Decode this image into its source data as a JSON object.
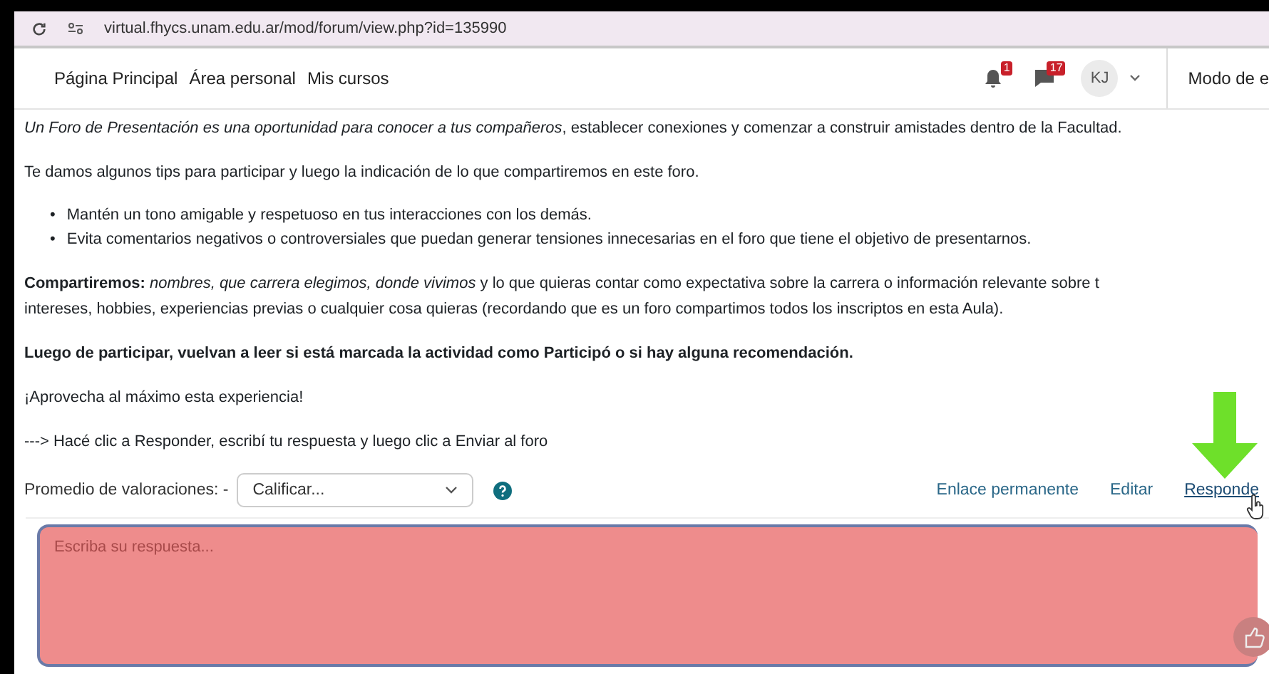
{
  "browser": {
    "url": "virtual.fhycs.unam.edu.ar/mod/forum/view.php?id=135990"
  },
  "nav": {
    "links": [
      "Página Principal",
      "Área personal",
      "Mis cursos"
    ],
    "notifications_badge": "1",
    "messages_badge": "17",
    "avatar_initials": "KJ",
    "edit_mode_label": "Modo de e"
  },
  "post": {
    "paragraphs": [
      {
        "kind": "text",
        "lines": [
          "*Un Foro de  Presentación es una oportunidad para conocer a tus compañeros*, establecer conexiones y comenzar a construir amistades dentro de la Facultad."
        ]
      },
      {
        "kind": "text",
        "lines": [
          "Te damos algunos tips para participar y luego la indicación de lo que compartiremos en este foro."
        ]
      },
      {
        "kind": "list",
        "marker": "•",
        "items": [
          "Mantén un tono amigable y respetuoso en tus interacciones con los demás.",
          "Evita comentarios negativos o controversiales que puedan generar tensiones innecesarias en el foro que tiene el objetivo de presentarnos."
        ]
      },
      {
        "kind": "text",
        "lines": [
          "**Compartiremos:**  *nombres, que carrera elegimos, donde vivimos* y lo que quieras contar como expectativa sobre la carrera o información relevante sobre t",
          "intereses, hobbies, experiencias previas o cualquier cosa quieras (recordando que es un foro compartimos todos los inscriptos en esta Aula)."
        ]
      },
      {
        "kind": "bold",
        "lines": [
          "Luego de participar, vuelvan a leer si está marcada la actividad como Participó o si hay alguna recomendación."
        ]
      },
      {
        "kind": "text",
        "lines": [
          "¡Aprovecha al máximo esta experiencia!"
        ]
      },
      {
        "kind": "text",
        "lines": [
          "---> Hacé clic a Responder, escribí tu respuesta y luego clic a Enviar al foro"
        ]
      }
    ]
  },
  "rating": {
    "label": "Promedio de valoraciones: -",
    "select_value": "Calificar..."
  },
  "actions": [
    {
      "label": "Enlace permanente",
      "hovered": false
    },
    {
      "label": "Editar",
      "hovered": false
    },
    {
      "label": "Responde",
      "hovered": true
    }
  ],
  "reply": {
    "placeholder": "Escriba su respuesta..."
  }
}
